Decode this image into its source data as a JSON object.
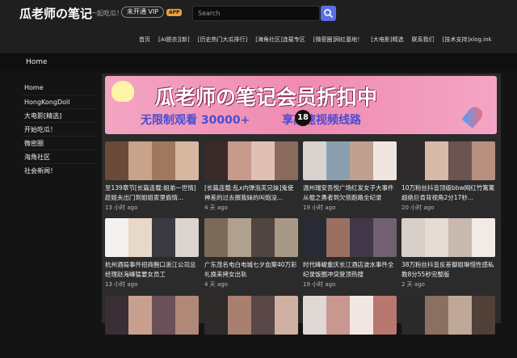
{
  "header": {
    "logo": "瓜老师の笔记",
    "slogan": "一起吃瓜！",
    "vip_label": "未开通 VIP",
    "app_badge": "APP",
    "search_placeholder": "Search",
    "nav": [
      "首页",
      "[AI脱衣][新]",
      "[历史热门大瓜排行]",
      "[海角社区]连载专区",
      "[微密圈]网红基地！",
      "[大电影]精选",
      "联系我们",
      "[技术支持]xlog.ink"
    ]
  },
  "breadcrumb": "Home",
  "sidebar": [
    "Home",
    "HongKongDoll",
    "大电影[精选]",
    "开始吃瓜！",
    "微密圈",
    "海角社区",
    "社会新闻！"
  ],
  "banner": {
    "title": "瓜老师の笔记会员折扣中",
    "subtitle_left": "无限制观看 30000+",
    "badge": "18",
    "subtitle_right": "享高速视频线路"
  },
  "cards": [
    {
      "title": "至139章节[长篇连载:姐弟一世情]趁姐夫出门到姐姐家里偷情...",
      "time": "13 小时 ago",
      "thumb": [
        "#6b4a3a",
        "#c9a28a",
        "#a07860",
        "#d8b7a0"
      ]
    },
    {
      "title": "[长篇连载:乱x内弹泡芙兄妹]鬼使神差的过去撰我妹的叫炮没...",
      "time": "4 天 ago",
      "thumb": [
        "#3a2a2a",
        "#c79a8a",
        "#e0c0b5",
        "#8a6a5a"
      ]
    },
    {
      "title": "温州瑞安吾悦广场红发女子大事件从棍之勇者到欠债跑路全纪录",
      "time": "19 小时 ago",
      "thumb": [
        "#d9d3cf",
        "#8aa0b0",
        "#c0a090",
        "#f0e6e0"
      ]
    },
    {
      "title": "10万粉丝抖音顶级bbw网红竹篱篱超绝巨肯背视角2分17秒...",
      "time": "20 小时 ago",
      "thumb": [
        "#2e2a2a",
        "#d7b9a8",
        "#6a5550",
        "#b89080"
      ]
    },
    {
      "title": "杭州酒局事件招商鲍口浙江公司总经理赵海峰猛要女员工",
      "time": "13 小时 ago",
      "thumb": [
        "#f4f1ee",
        "#e8d8c8",
        "#3a3a40",
        "#dcd4d0"
      ]
    },
    {
      "title": "广东茂名电白电城七夕血案40万彩礼换来拷女出轨",
      "time": "4 天 ago",
      "thumb": [
        "#7a6a5a",
        "#b0a090",
        "#504540",
        "#a89888"
      ]
    },
    {
      "title": "时代峰峻重庆长江酒店波水事件全纪录饭圈冲突登顶热搜",
      "time": "19 小时 ago",
      "thumb": [
        "#2a2a35",
        "#9a7060",
        "#403848",
        "#706070"
      ]
    },
    {
      "title": "38万粉丝抖音反差御姐琳惜性感私教8分55秒完整版",
      "time": "2 天 ago",
      "thumb": [
        "#d8cfc8",
        "#e6dcd5",
        "#c8b8ae",
        "#f0ebe7"
      ]
    },
    {
      "title": "",
      "time": "",
      "thumb": [
        "#3a2f35",
        "#c8a090",
        "#6a5058",
        "#b08878"
      ]
    },
    {
      "title": "",
      "time": "",
      "thumb": [
        "#2f2a2a",
        "#a88070",
        "#5a4848",
        "#d0b0a0"
      ]
    },
    {
      "title": "",
      "time": "",
      "thumb": [
        "#e0d8d4",
        "#c89890",
        "#f2e6e2",
        "#b87870"
      ]
    },
    {
      "title": "",
      "time": "",
      "thumb": [
        "#2a2a2a",
        "#8a7060",
        "#c0a898",
        "#504038"
      ]
    }
  ]
}
